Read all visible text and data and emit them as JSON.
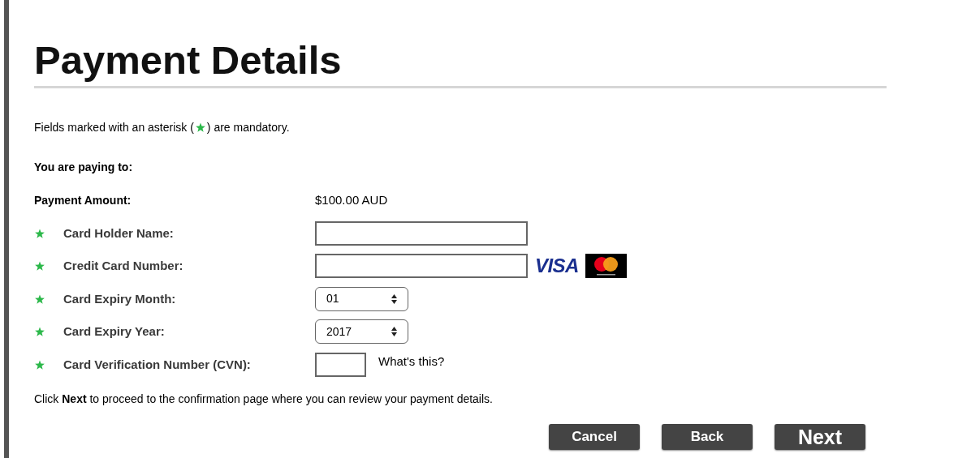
{
  "title": "Payment Details",
  "intro": {
    "before": "Fields marked with an asterisk (",
    "after": ") are mandatory."
  },
  "paying_to": {
    "label": "You are paying to:"
  },
  "amount": {
    "label": "Payment Amount:",
    "value": "$100.00 AUD"
  },
  "fields": [
    {
      "kind": "text",
      "label": "Card Holder Name:",
      "required": true
    },
    {
      "kind": "text",
      "label": "Credit Card Number:",
      "required": true,
      "logos": [
        {
          "kind": "visa",
          "label": "VISA"
        },
        {
          "kind": "mastercard"
        }
      ]
    },
    {
      "kind": "select",
      "label": "Card Expiry Month:",
      "required": true,
      "value": "01"
    },
    {
      "kind": "select",
      "label": "Card Expiry Year:",
      "required": true,
      "value": "2017"
    },
    {
      "kind": "short_text",
      "label": "Card Verification Number (CVN):",
      "required": true,
      "help": "What's this?"
    }
  ],
  "note": "Click **Next** to proceed to the confirmation page where you can review your payment details.",
  "buttons": [
    {
      "label": "Cancel",
      "primary": false
    },
    {
      "label": "Back",
      "primary": false
    },
    {
      "label": "Next",
      "primary": true
    }
  ]
}
